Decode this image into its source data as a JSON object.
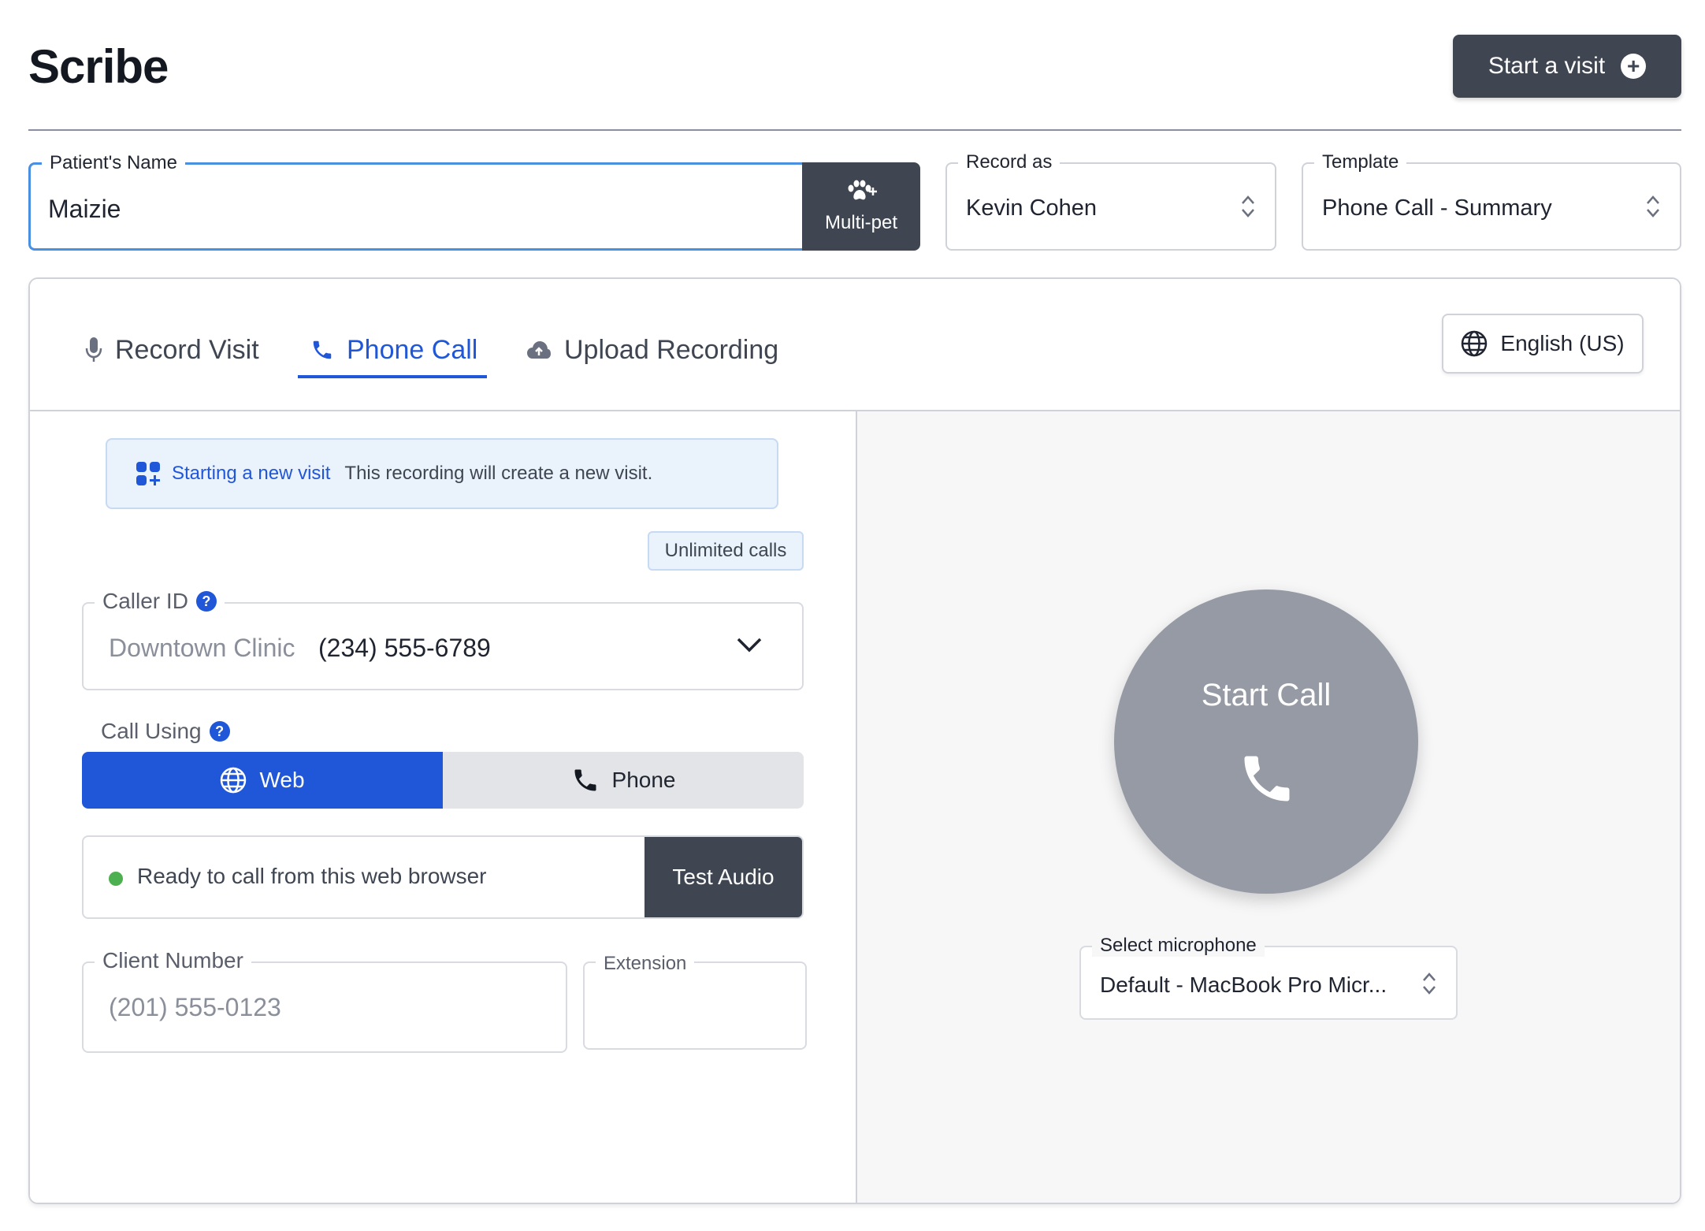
{
  "header": {
    "title": "Scribe",
    "start_visit_label": "Start a visit"
  },
  "fields": {
    "patient_name_label": "Patient's Name",
    "patient_name_value": "Maizie",
    "multi_pet_label": "Multi-pet",
    "record_as_label": "Record as",
    "record_as_value": "Kevin Cohen",
    "template_label": "Template",
    "template_value": "Phone Call - Summary"
  },
  "tabs": [
    {
      "label": "Record Visit",
      "icon": "microphone-icon",
      "active": false
    },
    {
      "label": "Phone Call",
      "icon": "phone-icon",
      "active": true
    },
    {
      "label": "Upload Recording",
      "icon": "cloud-upload-icon",
      "active": false
    }
  ],
  "language": {
    "label": "English (US)",
    "icon": "globe-icon"
  },
  "notice": {
    "title": "Starting a new visit",
    "message": "This recording will create a new visit."
  },
  "badge": {
    "label": "Unlimited calls"
  },
  "caller_id": {
    "label": "Caller ID",
    "clinic": "Downtown Clinic",
    "number": "(234) 555-6789"
  },
  "call_using": {
    "label": "Call Using",
    "options": [
      {
        "label": "Web",
        "selected": true
      },
      {
        "label": "Phone",
        "selected": false
      }
    ]
  },
  "status": {
    "message": "Ready to call from this web browser",
    "test_audio_label": "Test Audio"
  },
  "client_number": {
    "label": "Client Number",
    "placeholder": "(201) 555-0123"
  },
  "extension": {
    "label": "Extension",
    "value": ""
  },
  "start_call": {
    "label": "Start Call"
  },
  "microphone": {
    "label": "Select microphone",
    "value": "Default - MacBook Pro Micr..."
  },
  "colors": {
    "accent": "#2056d8",
    "dark_button": "#3f4652",
    "ready_dot": "#4caf50",
    "call_button": "#959aa4"
  }
}
